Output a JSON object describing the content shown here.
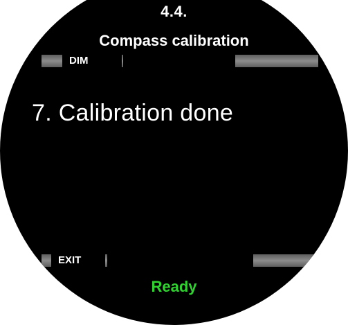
{
  "header": {
    "section_number": "4.4.",
    "title": "Compass calibration"
  },
  "softkeys": {
    "top_left_label": "DIM",
    "bottom_left_label": "EXIT"
  },
  "main": {
    "message": "7. Calibration done"
  },
  "status": {
    "text": "Ready",
    "color": "#2fd22f"
  },
  "colors": {
    "background": "#000000",
    "text": "#ffffff",
    "softkey_bar": "#8c8c8c"
  }
}
